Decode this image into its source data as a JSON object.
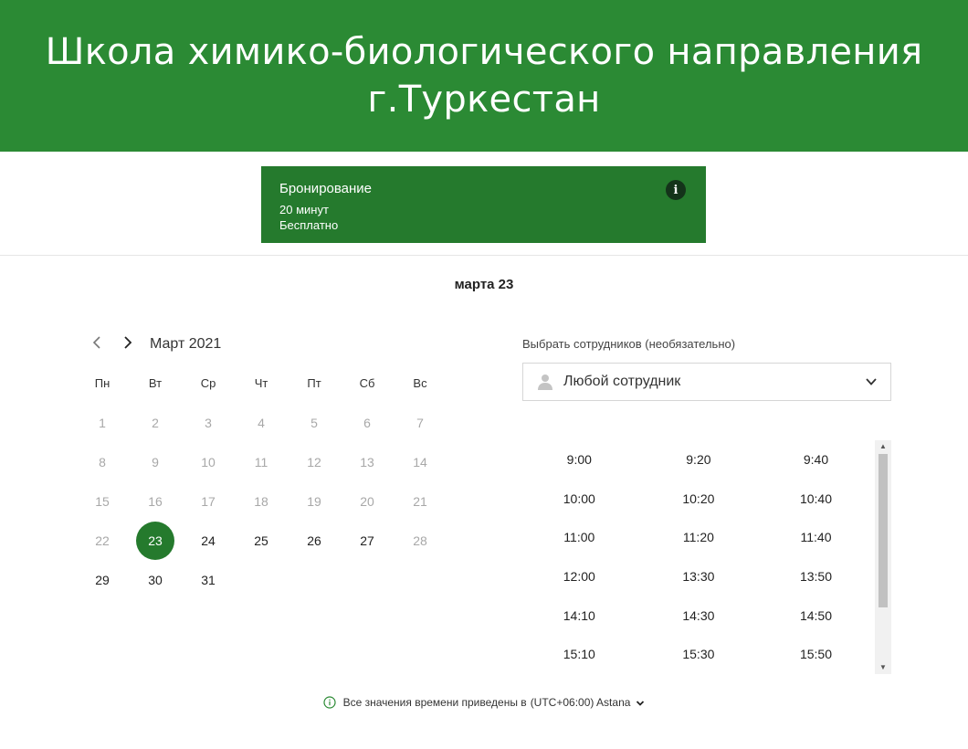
{
  "header": {
    "title_line1": "Школа химико-биологического направления",
    "title_line2": "г.Туркестан",
    "bg_color": "#2b8a34"
  },
  "service": {
    "name": "Бронирование",
    "duration": "20 минут",
    "price": "Бесплатно",
    "info_icon": "i",
    "bg_color": "#257a2d"
  },
  "selected_date_heading": "марта 23",
  "calendar": {
    "prev_icon": "chevron-left-icon",
    "next_icon": "chevron-right-icon",
    "month_label": "Март 2021",
    "weekdays": [
      "Пн",
      "Вт",
      "Ср",
      "Чт",
      "Пт",
      "Сб",
      "Вс"
    ],
    "weeks": [
      [
        {
          "d": "1",
          "s": "disabled"
        },
        {
          "d": "2",
          "s": "disabled"
        },
        {
          "d": "3",
          "s": "disabled"
        },
        {
          "d": "4",
          "s": "disabled"
        },
        {
          "d": "5",
          "s": "disabled"
        },
        {
          "d": "6",
          "s": "disabled"
        },
        {
          "d": "7",
          "s": "disabled"
        }
      ],
      [
        {
          "d": "8",
          "s": "disabled"
        },
        {
          "d": "9",
          "s": "disabled"
        },
        {
          "d": "10",
          "s": "disabled"
        },
        {
          "d": "11",
          "s": "disabled"
        },
        {
          "d": "12",
          "s": "disabled"
        },
        {
          "d": "13",
          "s": "disabled"
        },
        {
          "d": "14",
          "s": "disabled"
        }
      ],
      [
        {
          "d": "15",
          "s": "disabled"
        },
        {
          "d": "16",
          "s": "disabled"
        },
        {
          "d": "17",
          "s": "disabled"
        },
        {
          "d": "18",
          "s": "disabled"
        },
        {
          "d": "19",
          "s": "disabled"
        },
        {
          "d": "20",
          "s": "disabled"
        },
        {
          "d": "21",
          "s": "disabled"
        }
      ],
      [
        {
          "d": "22",
          "s": "disabled"
        },
        {
          "d": "23",
          "s": "selected"
        },
        {
          "d": "24",
          "s": "available"
        },
        {
          "d": "25",
          "s": "available"
        },
        {
          "d": "26",
          "s": "available"
        },
        {
          "d": "27",
          "s": "available"
        },
        {
          "d": "28",
          "s": "disabled"
        }
      ],
      [
        {
          "d": "29",
          "s": "available"
        },
        {
          "d": "30",
          "s": "available"
        },
        {
          "d": "31",
          "s": "available"
        },
        {
          "d": "",
          "s": "empty"
        },
        {
          "d": "",
          "s": "empty"
        },
        {
          "d": "",
          "s": "empty"
        },
        {
          "d": "",
          "s": "empty"
        }
      ]
    ],
    "selected_color": "#257a2d"
  },
  "staff": {
    "label": "Выбрать сотрудников (необязательно)",
    "value": "Любой сотрудник",
    "icon": "person-icon",
    "dropdown_icon": "chevron-down-icon"
  },
  "time_slots": [
    [
      "9:00",
      "9:20",
      "9:40"
    ],
    [
      "10:00",
      "10:20",
      "10:40"
    ],
    [
      "11:00",
      "11:20",
      "11:40"
    ],
    [
      "12:00",
      "13:30",
      "13:50"
    ],
    [
      "14:10",
      "14:30",
      "14:50"
    ],
    [
      "15:10",
      "15:30",
      "15:50"
    ]
  ],
  "timezone_note": {
    "text": "Все значения времени приведены в",
    "value": "(UTC+06:00) Astana",
    "icon": "info-circle-icon",
    "dropdown_icon": "chevron-down-icon"
  }
}
